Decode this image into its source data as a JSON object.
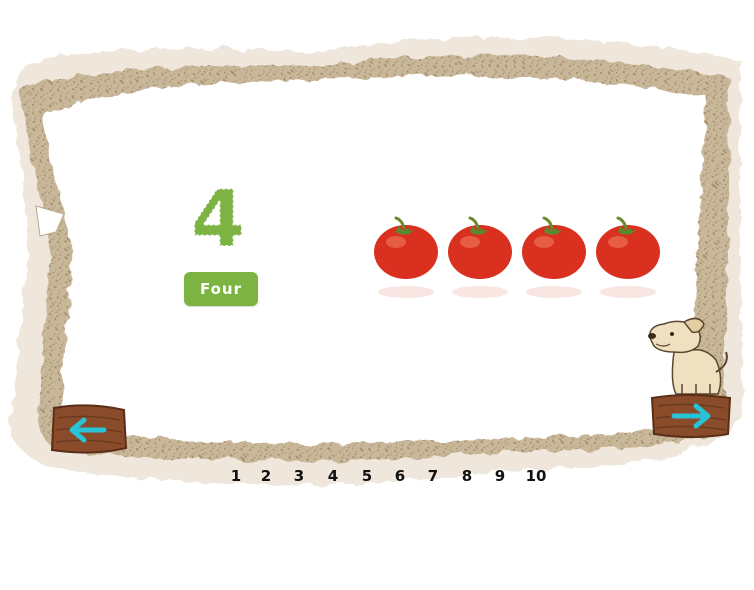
{
  "lesson": {
    "numeral": "4",
    "word": "Four",
    "item_icon": "tomato-icon",
    "item_count": 4
  },
  "navigation": {
    "prev_icon": "arrow-left-icon",
    "next_icon": "arrow-right-icon"
  },
  "mascot_icon": "dog-icon",
  "pager": {
    "pages": [
      "1",
      "2",
      "3",
      "4",
      "5",
      "6",
      "7",
      "8",
      "9",
      "10"
    ]
  },
  "colors": {
    "numeral_green": "#7cb342",
    "badge_green": "#7cb342",
    "arrow_teal": "#29c3d8",
    "tomato_red": "#d9301f"
  }
}
